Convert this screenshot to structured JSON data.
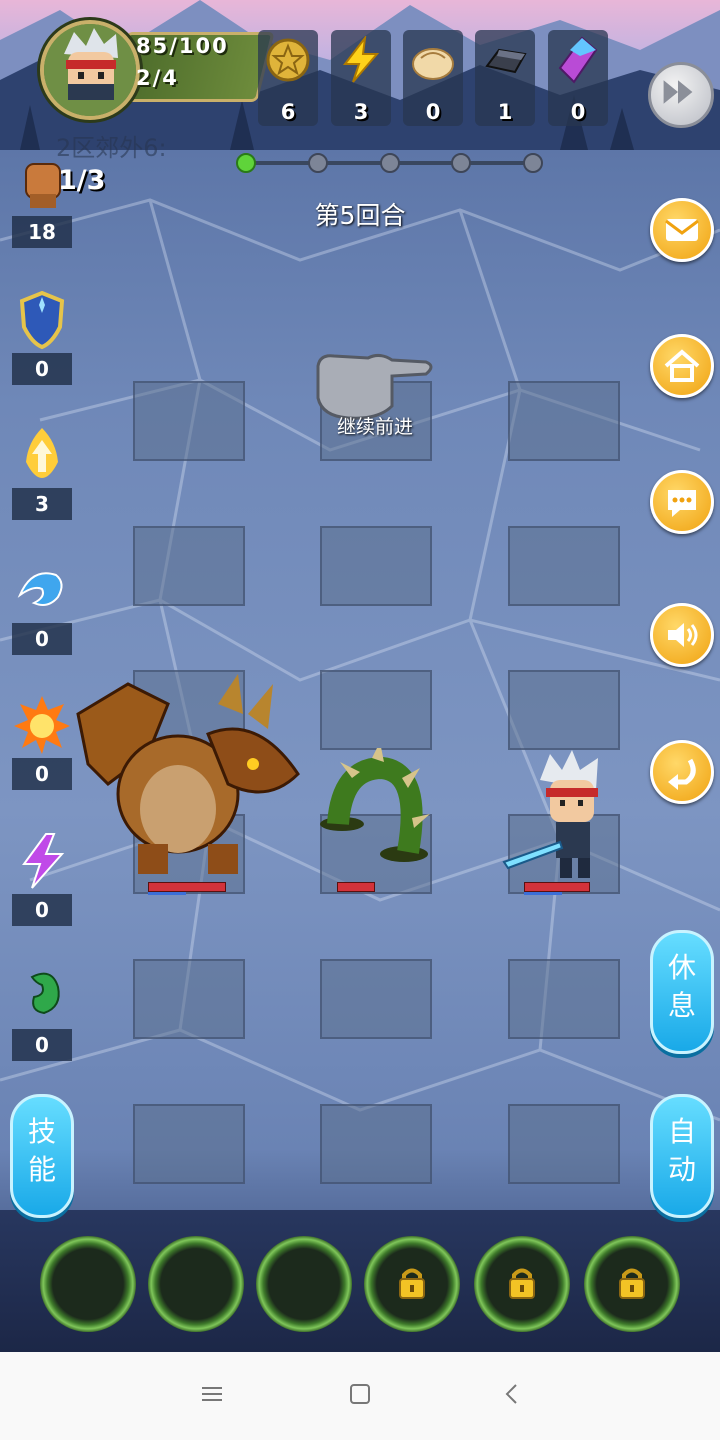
{
  "hud": {
    "hp_text": "85/100",
    "stage_text": "2/4",
    "resources": [
      {
        "name": "gold-coin-icon",
        "value": "6"
      },
      {
        "name": "lightning-icon",
        "value": "3"
      },
      {
        "name": "bun-icon",
        "value": "0"
      },
      {
        "name": "iron-ingot-icon",
        "value": "1"
      },
      {
        "name": "crystal-icon",
        "value": "0"
      }
    ]
  },
  "battle": {
    "area_label": "2区郊外6:",
    "wave_text": "1/3",
    "round_text": "第5回合",
    "continue_hint": "继续前进"
  },
  "stats": [
    {
      "icon": "fist-icon",
      "count": "18"
    },
    {
      "icon": "shield-icon",
      "count": "0"
    },
    {
      "icon": "holy-arrow-icon",
      "count": "3"
    },
    {
      "icon": "water-wave-icon",
      "count": "0"
    },
    {
      "icon": "fire-burst-icon",
      "count": "0"
    },
    {
      "icon": "lightning-bolt-icon",
      "count": "0"
    },
    {
      "icon": "poison-drop-icon",
      "count": "0"
    }
  ],
  "buttons": {
    "skill": "技能",
    "rest": "休息",
    "auto": "自动"
  },
  "colors": {
    "accent_orange": "#f0a210",
    "pill_blue": "#19a9e8",
    "hp_red": "#d3323a"
  }
}
